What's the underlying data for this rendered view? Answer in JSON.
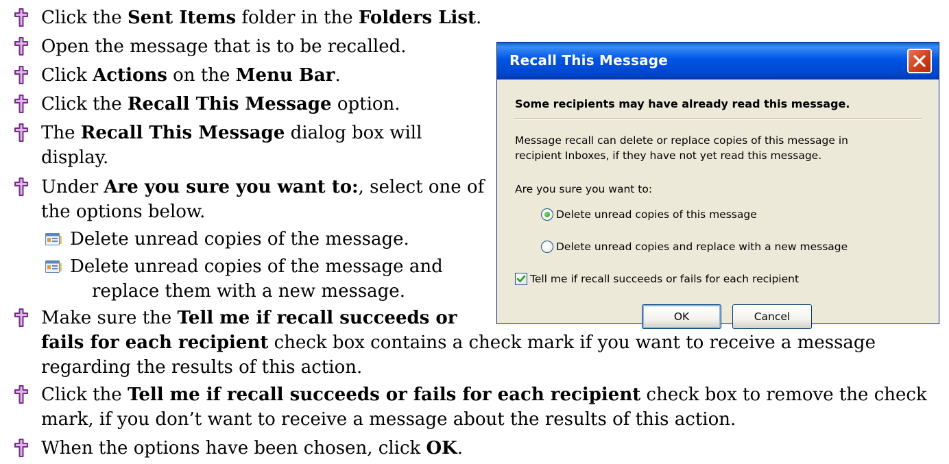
{
  "steps": {
    "s1": {
      "pre": "Click the ",
      "b1": "Sent Items",
      "mid": " folder in the ",
      "b2": "Folders List",
      "post": "."
    },
    "s2": {
      "text": "Open the message that is to be recalled."
    },
    "s3": {
      "pre": "Click ",
      "b1": "Actions",
      "mid": " on the ",
      "b2": "Menu Bar",
      "post": "."
    },
    "s4": {
      "pre": "Click the ",
      "b1": "Recall This Message",
      "post": " option."
    },
    "s5": {
      "pre": "The ",
      "b1": "Recall This Message",
      "post": " dialog box will",
      "cont": "display."
    },
    "s6": {
      "pre": "Under ",
      "b1": "Are you sure you want to:",
      "post": ", select one of",
      "cont": "the options below."
    },
    "sub1": {
      "text": "Delete unread copies of the message."
    },
    "sub2": {
      "text": "Delete unread copies of the message and",
      "cont": "replace them with a new message."
    },
    "s7": {
      "pre": "Make sure the ",
      "b1": "Tell me if recall succeeds or",
      "b2": "fails for each recipient",
      "post": " check box contains a check mark if you want to receive a message",
      "cont": "regarding the results of this action."
    },
    "s8": {
      "pre": "Click the ",
      "b1": "Tell me if recall succeeds or fails for each recipient",
      "post": " check box to remove the check",
      "cont": "mark, if you don’t want to receive a message about the results of this action."
    },
    "s9": {
      "pre": "When the options have been chosen, click ",
      "b1": "OK",
      "post": "."
    }
  },
  "dialog": {
    "title": "Recall This Message",
    "heading": "Some recipients may have already read this message.",
    "description_line1": "Message recall can delete or replace copies of this message in",
    "description_line2": "recipient Inboxes, if they have not yet read this message.",
    "question": "Are you sure you want to:",
    "option1": "Delete unread copies of this message",
    "option2": "Delete unread copies and replace with a new message",
    "option1_selected": true,
    "checkbox_label": "Tell me if recall succeeds or fails for each recipient",
    "checkbox_checked": true,
    "ok_label": "OK",
    "cancel_label": "Cancel"
  },
  "colors": {
    "bullet_cross": "#7a2a8c",
    "titlebar": "#0055e5",
    "dialog_bg": "#ece9d8",
    "close_button": "#d23f1a"
  },
  "icons": {
    "step_bullet": "cross-bullet-icon",
    "sub_bullet": "contact-card-icon",
    "close": "close-icon",
    "checkmark": "checkmark-icon"
  }
}
